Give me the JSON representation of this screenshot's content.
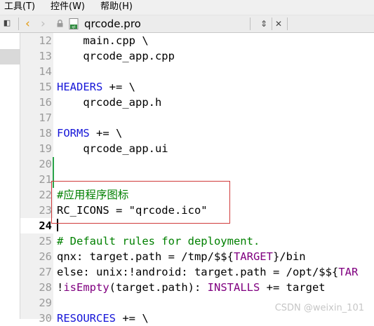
{
  "menu": [
    "工具(T)",
    "控件(W)",
    "帮助(H)"
  ],
  "toolbar": {
    "filename": "qrcode.pro",
    "back_glyph": "‹",
    "forward_glyph": "›",
    "updown_glyph": "⇕",
    "close_glyph": "✕",
    "sidebar_glyph": "◧"
  },
  "lines": [
    {
      "n": "12",
      "text": "    main.cpp \\"
    },
    {
      "n": "13",
      "text": "    qrcode_app.cpp"
    },
    {
      "n": "14",
      "text": ""
    },
    {
      "n": "15",
      "kw": "HEADERS",
      "rest": " += \\"
    },
    {
      "n": "16",
      "text": "    qrcode_app.h"
    },
    {
      "n": "17",
      "text": ""
    },
    {
      "n": "18",
      "kw": "FORMS",
      "rest": " += \\"
    },
    {
      "n": "19",
      "text": "    qrcode_app.ui"
    },
    {
      "n": "20",
      "text": ""
    },
    {
      "n": "21",
      "text": ""
    },
    {
      "n": "22",
      "comment": "#应用程序图标"
    },
    {
      "n": "23",
      "text": "RC_ICONS = \"qrcode.ico\""
    },
    {
      "n": "24",
      "text": ""
    },
    {
      "n": "25",
      "comment": "# Default rules for deployment."
    },
    {
      "n": "26",
      "text": "qnx: target.path = /tmp/$${",
      "var": "TARGET",
      "after": "}/bin"
    },
    {
      "n": "27",
      "text": "else: unix:!android: target.path = /opt/$${",
      "var": "TAR",
      "after": ""
    },
    {
      "n": "28",
      "text": "!",
      "fn": "isEmpty",
      "fnrest": "(target.path): ",
      "kw2": "INSTALLS",
      "rest": " += target"
    },
    {
      "n": "29",
      "text": ""
    },
    {
      "n": "30",
      "kw": "RESOURCES",
      "rest": " += \\"
    }
  ],
  "current_line": "24",
  "watermark": "CSDN @weixin_101"
}
